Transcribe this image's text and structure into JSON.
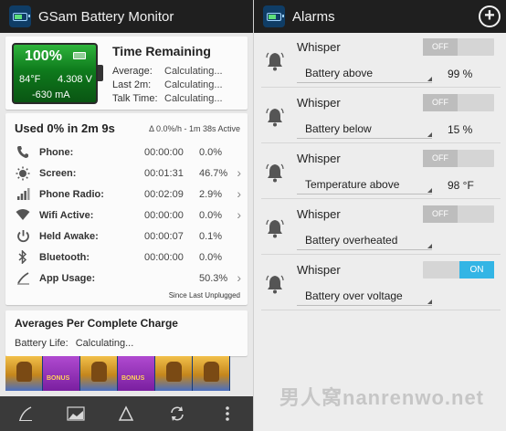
{
  "left_app": {
    "title": "GSam Battery Monitor",
    "battery": {
      "percent": "100%",
      "temperature": "84°F",
      "voltage": "4.308 V",
      "current": "-630 mA"
    },
    "time_remaining": {
      "title": "Time Remaining",
      "rows": [
        {
          "label": "Average:",
          "value": "Calculating..."
        },
        {
          "label": "Last 2m:",
          "value": "Calculating..."
        },
        {
          "label": "Talk Time:",
          "value": "Calculating..."
        }
      ]
    },
    "usage": {
      "header": "Used 0% in 2m 9s",
      "subheader": "Δ 0.0%/h - 1m 38s Active",
      "rows": [
        {
          "label": "Phone:",
          "time": "00:00:00",
          "pct": "0.0%",
          "icon": "phone-icon",
          "chevron": false
        },
        {
          "label": "Screen:",
          "time": "00:01:31",
          "pct": "46.7%",
          "icon": "screen-brightness-icon",
          "chevron": true
        },
        {
          "label": "Phone Radio:",
          "time": "00:02:09",
          "pct": "2.9%",
          "icon": "signal-bars-icon",
          "chevron": true
        },
        {
          "label": "Wifi Active:",
          "time": "00:00:00",
          "pct": "0.0%",
          "icon": "wifi-icon",
          "chevron": true
        },
        {
          "label": "Held Awake:",
          "time": "00:00:07",
          "pct": "0.1%",
          "icon": "power-icon",
          "chevron": false
        },
        {
          "label": "Bluetooth:",
          "time": "00:00:00",
          "pct": "0.0%",
          "icon": "bluetooth-icon",
          "chevron": false
        },
        {
          "label": "App Usage:",
          "time": "",
          "pct": "50.3%",
          "icon": "app-usage-icon",
          "chevron": true
        }
      ],
      "footer": "Since Last Unplugged"
    },
    "averages": {
      "title": "Averages Per Complete Charge",
      "battery_life_label": "Battery Life:",
      "battery_life_value": "Calculating..."
    },
    "ad": {
      "tiles": [
        "pharaoh",
        "bonus",
        "pharaoh",
        "bonus",
        "pharaoh",
        "pharaoh"
      ],
      "bonus_label": "BONUS"
    },
    "bottom_bar": [
      "graph-icon",
      "chart-icon",
      "delta-icon",
      "refresh-icon",
      "overflow-menu-icon"
    ]
  },
  "right_app": {
    "title": "Alarms",
    "alarms": [
      {
        "name": "Whisper",
        "toggle": "OFF",
        "on": false,
        "condition": "Battery above",
        "value": "99 %"
      },
      {
        "name": "Whisper",
        "toggle": "OFF",
        "on": false,
        "condition": "Battery below",
        "value": "15 %"
      },
      {
        "name": "Whisper",
        "toggle": "OFF",
        "on": false,
        "condition": "Temperature above",
        "value": "98 °F"
      },
      {
        "name": "Whisper",
        "toggle": "OFF",
        "on": false,
        "condition": "Battery overheated",
        "value": ""
      },
      {
        "name": "Whisper",
        "toggle": "ON",
        "on": true,
        "condition": "Battery over voltage",
        "value": ""
      }
    ]
  },
  "watermark": "男人窝nanrenwo.net",
  "colors": {
    "action_bar": "#1f1f1f",
    "toggle_on": "#33b5e5",
    "toggle_off": "#bdbdbd",
    "battery_green": "#2fb43c"
  }
}
